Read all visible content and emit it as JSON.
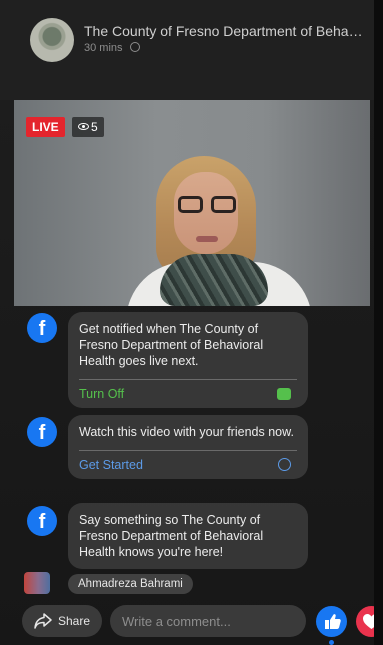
{
  "header": {
    "page_title": "The County of Fresno Department of Behavioral Health",
    "subtitle": "30 mins"
  },
  "video": {
    "live_label": "LIVE",
    "viewer_count": "5"
  },
  "cards": [
    {
      "text": "Get notified when The County of Fresno Department of Behavioral Health goes live next.",
      "action_label": "Turn Off",
      "icon": "facebook-icon"
    },
    {
      "text": "Watch this video with your friends now.",
      "action_label": "Get Started",
      "icon": "facebook-icon"
    },
    {
      "text": "Say something so The County of Fresno Department of Behavioral Health knows you're here!",
      "icon": "facebook-icon"
    }
  ],
  "comment": {
    "author": "Ahmadreza Bahrami"
  },
  "bottom_bar": {
    "share_label": "Share",
    "comment_placeholder": "Write a comment..."
  },
  "colors": {
    "live_red": "#e4252d",
    "facebook_blue": "#1877f2",
    "action_green": "#55c04c",
    "action_blue": "#5c9be8",
    "love_red": "#e9334d"
  }
}
